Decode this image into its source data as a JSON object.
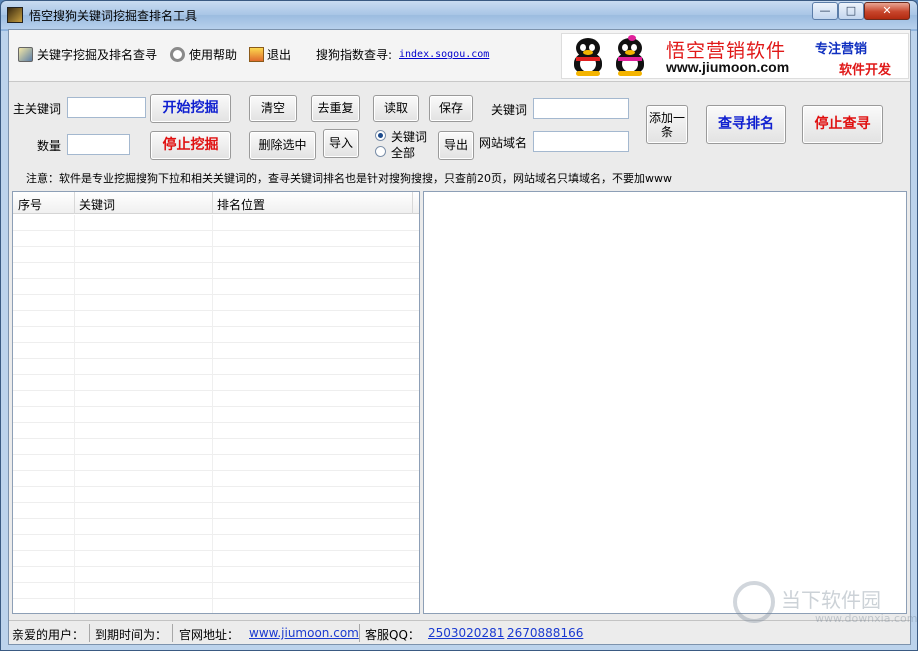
{
  "window": {
    "title": "悟空搜狗关键词挖掘查排名工具",
    "controls": {
      "minimize": "—",
      "maximize": "□",
      "close": "✕"
    }
  },
  "toolbar": {
    "mine_rank_label": "关键字挖掘及排名查寻",
    "help_label": "使用帮助",
    "exit_label": "退出",
    "sogou_index_label": "搜狗指数查寻:",
    "sogou_index_link": "index.sogou.com"
  },
  "banner": {
    "brand_cn": "悟空营销软件",
    "brand_url": "www.jiumoon.com",
    "tag1": "专注营销",
    "tag2": "软件开发"
  },
  "controls": {
    "main_keyword_label": "主关键词",
    "main_keyword_value": "",
    "count_label": "数量",
    "count_value": "",
    "start_mine_button": "开始挖掘",
    "stop_mine_button": "停止挖掘",
    "clear_button": "清空",
    "dedupe_button": "去重复",
    "read_button": "读取",
    "save_button": "保存",
    "delete_selected_button": "删除选中",
    "import_button": "导入",
    "export_button": "导出",
    "radio_keyword": "关键词",
    "radio_all": "全部",
    "radio_selected": "keyword",
    "keyword_label": "关键词",
    "keyword_value": "",
    "site_domain_label": "网站域名",
    "site_domain_value": "",
    "add_one_button": "添加一条",
    "check_rank_button": "查寻排名",
    "stop_check_button": "停止查寻",
    "notice": "注意：软件是专业挖掘搜狗下拉和相关关键词的，查寻关键词排名也是针对搜狗搜搜，只查前20页，网站域名只填域名，不要加www"
  },
  "table": {
    "columns": [
      "序号",
      "关键词",
      "排名位置"
    ],
    "rows": []
  },
  "statusbar": {
    "user_label": "亲爱的用户：",
    "expire_label": "到期时间为：",
    "site_label": "官网地址：",
    "site_link": "www.jiumoon.com",
    "support_label": "客服QQ：",
    "qq1": "2503020281",
    "qq2": "2670888166"
  },
  "watermark": {
    "text_cn": "当下软件园",
    "url": "www.downxia.com"
  }
}
